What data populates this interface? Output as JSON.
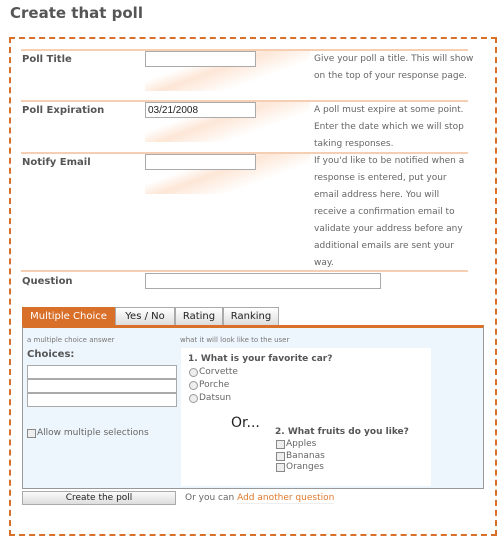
{
  "title": "Create that poll",
  "rows": [
    {
      "label": "Poll Title",
      "value": "",
      "desc": "Give your poll a title. This will show on the top of your response page."
    },
    {
      "label": "Poll Expiration",
      "value": "03/21/2008",
      "desc": "A poll must expire at some point. Enter the date which we will stop taking responses."
    },
    {
      "label": "Notify Email",
      "value": "",
      "desc": "If you'd like to be notified when a response is entered, put your email address here. You will receive a confirmation email to validate your address before any additional emails are sent your way."
    }
  ],
  "question": {
    "label": "Question",
    "value": ""
  },
  "tabs": [
    {
      "label": "Multiple Choice",
      "active": true
    },
    {
      "label": "Yes / No"
    },
    {
      "label": "Rating"
    },
    {
      "label": "Ranking"
    }
  ],
  "panel": {
    "left_caption": "a multiple choice answer",
    "right_caption": "what it will look like to the user",
    "choices_label": "Choices:",
    "allow_multiple": "Allow multiple selections"
  },
  "preview": {
    "q1": "1. What is your favorite car?",
    "q1_options": [
      "Corvette",
      "Porche",
      "Datsun"
    ],
    "or": "Or...",
    "q2": "2. What fruits do you like?",
    "q2_options": [
      "Apples",
      "Bananas",
      "Oranges"
    ]
  },
  "footer": {
    "create_button": "Create the poll",
    "or_text": "Or you can",
    "add_link": "Add another question"
  },
  "colors": {
    "accent": "#d9702a",
    "panel_bg": "#eef6fd"
  }
}
